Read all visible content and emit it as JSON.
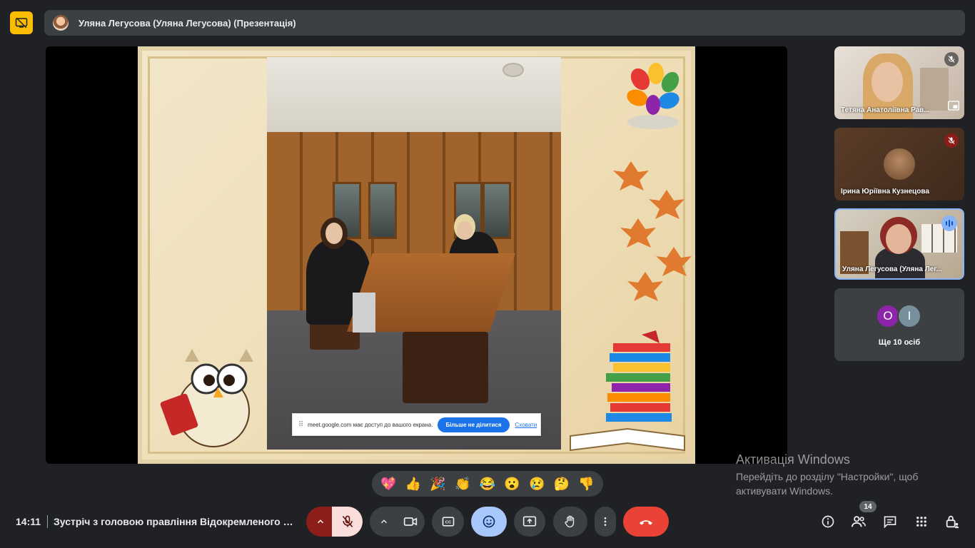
{
  "header": {
    "presenter_title": "Уляна Легусова (Уляна Легусова) (Презентація)"
  },
  "share_notice": {
    "text": "meet.google.com має доступ до вашого екрана.",
    "stop_label": "Більше не ділитися",
    "hide_label": "Сховати"
  },
  "participants": [
    {
      "name": "Тетяна Анатоліївна Рав...",
      "muted": true
    },
    {
      "name": "Ірина Юріївна Кузнецова",
      "muted": true
    },
    {
      "name": "Уляна Легусова (Уляна Лег...",
      "speaking": true
    }
  ],
  "others": {
    "avatars": [
      {
        "initial": "О",
        "color": "#8e24aa"
      },
      {
        "initial": "І",
        "color": "#78909c"
      }
    ],
    "label": "Ще 10 осіб"
  },
  "watermark": {
    "title": "Активація Windows",
    "text": "Перейдіть до розділу \"Настройки\", щоб активувати Windows."
  },
  "reactions": [
    "💖",
    "👍",
    "🎉",
    "👏",
    "😂",
    "😮",
    "😢",
    "🤔",
    "👎"
  ],
  "footer": {
    "time": "14:11",
    "meeting_title": "Зустріч з головою правління Відокремленого п...",
    "participant_count": "14"
  },
  "colors": {
    "background": "#202124",
    "panel": "#3c4043",
    "accent_yellow": "#fbbc04",
    "mic_off": "#f9dedc",
    "mic_off_side": "#8c1d18",
    "reaction_active": "#a8c7fa",
    "hangup": "#ea4335"
  }
}
